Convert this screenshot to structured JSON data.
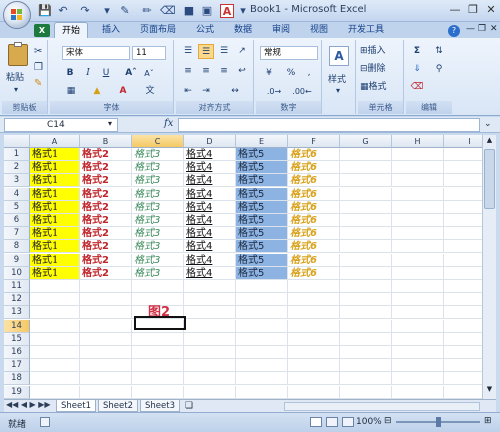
{
  "titlebar": {
    "title": "Book1 - Microsoft Excel"
  },
  "tabs": [
    {
      "label": "开始",
      "active": true
    },
    {
      "label": "插入"
    },
    {
      "label": "页面布局"
    },
    {
      "label": "公式"
    },
    {
      "label": "数据"
    },
    {
      "label": "审阅"
    },
    {
      "label": "视图"
    },
    {
      "label": "开发工具"
    }
  ],
  "ribbon": {
    "clipboard": {
      "paste_label": "粘贴",
      "group_label": "剪贴板"
    },
    "font": {
      "name": "宋体",
      "size": "11",
      "group_label": "字体",
      "bold": "B",
      "italic": "I",
      "underline": "U",
      "wen": "文"
    },
    "alignment": {
      "group_label": "对齐方式"
    },
    "number": {
      "format": "常规",
      "group_label": "数字",
      "percent": "%"
    },
    "styles": {
      "label": "样式"
    },
    "cells": {
      "insert": "插入",
      "delete": "删除",
      "format": "格式",
      "group_label": "单元格"
    },
    "editing": {
      "group_label": "编辑"
    }
  },
  "formula_bar": {
    "name_box": "C14",
    "fx": "fx",
    "formula": ""
  },
  "columns": [
    "A",
    "B",
    "C",
    "D",
    "E",
    "F",
    "G",
    "H",
    "I"
  ],
  "rows": [
    "1",
    "2",
    "3",
    "4",
    "5",
    "6",
    "7",
    "8",
    "9",
    "10",
    "11",
    "12",
    "13",
    "14",
    "15",
    "16",
    "17",
    "18",
    "19"
  ],
  "cells": {
    "col_a": "格式1",
    "col_b": "格式2",
    "col_c": "格式3",
    "col_d": "格式4",
    "col_e": "格式5",
    "col_f": "格式6"
  },
  "annotation": "图2",
  "sheets": [
    "Sheet1",
    "Sheet2",
    "Sheet3"
  ],
  "status": {
    "ready": "就绪",
    "zoom": "100%"
  }
}
